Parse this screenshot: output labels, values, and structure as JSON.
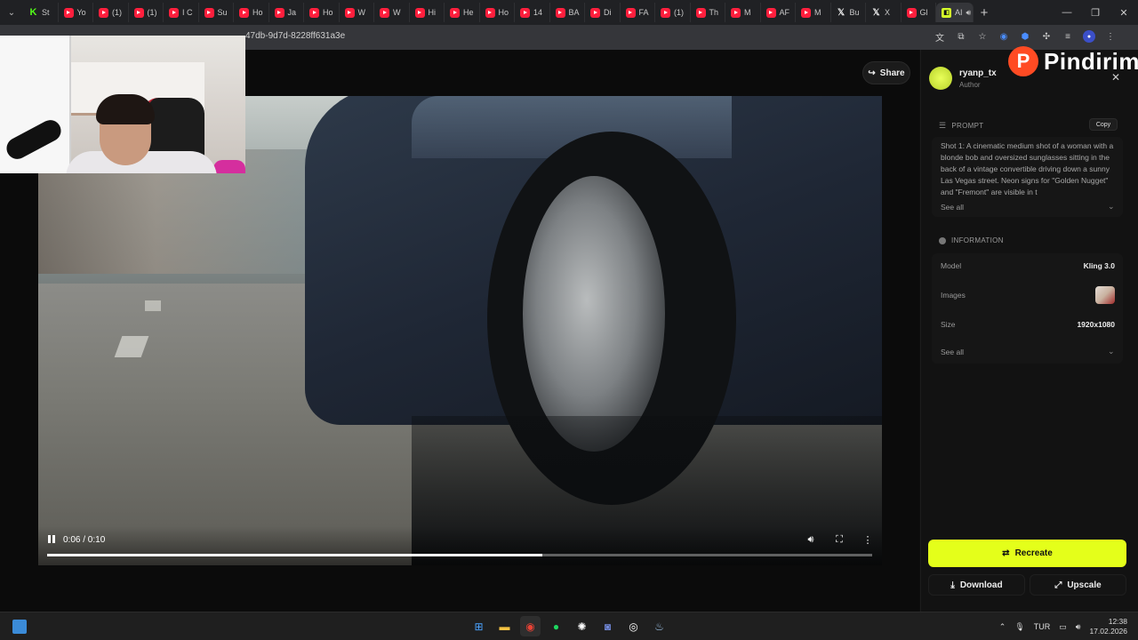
{
  "browser": {
    "tabs": [
      {
        "icon": "kick",
        "title": "St"
      },
      {
        "icon": "youtube",
        "title": "Yo"
      },
      {
        "icon": "youtube",
        "title": "(1)"
      },
      {
        "icon": "youtube",
        "title": "(1)"
      },
      {
        "icon": "youtube",
        "title": "I C"
      },
      {
        "icon": "youtube",
        "title": "Su"
      },
      {
        "icon": "youtube",
        "title": "Ho"
      },
      {
        "icon": "youtube",
        "title": "Ja"
      },
      {
        "icon": "youtube",
        "title": "Ho"
      },
      {
        "icon": "youtube",
        "title": "W"
      },
      {
        "icon": "youtube",
        "title": "W"
      },
      {
        "icon": "youtube",
        "title": "Hi"
      },
      {
        "icon": "youtube",
        "title": "He"
      },
      {
        "icon": "youtube",
        "title": "Ho"
      },
      {
        "icon": "youtube",
        "title": "14"
      },
      {
        "icon": "youtube",
        "title": "BA"
      },
      {
        "icon": "youtube",
        "title": "Di"
      },
      {
        "icon": "youtube",
        "title": "FA"
      },
      {
        "icon": "youtube",
        "title": "(1)"
      },
      {
        "icon": "youtube",
        "title": "Th"
      },
      {
        "icon": "youtube",
        "title": "M"
      },
      {
        "icon": "youtube",
        "title": "AF"
      },
      {
        "icon": "youtube",
        "title": "M"
      },
      {
        "icon": "x",
        "title": "Bu"
      },
      {
        "icon": "x",
        "title": "X"
      },
      {
        "icon": "youtube",
        "title": "Gl"
      },
      {
        "icon": "ai",
        "title": "AI"
      }
    ],
    "url": "47db-9d7d-8228ff631a3e"
  },
  "video": {
    "share_label": "Share",
    "time_label": "0:06 / 0:10",
    "progress_fraction": 0.6
  },
  "panel": {
    "brand": "Pindirim",
    "author_name": "ryanp_tx",
    "author_role": "Author",
    "prompt_heading": "PROMPT",
    "copy_label": "Copy",
    "prompt_text": "Shot 1: A cinematic medium shot of a woman with a blonde bob and oversized sunglasses sitting in the back of a vintage convertible driving down a sunny Las Vegas street. Neon signs for \"Golden Nugget\" and \"Fremont\" are visible in t",
    "see_all_prompt": "See all",
    "info_heading": "INFORMATION",
    "info": [
      {
        "key": "Model",
        "value": "Kling 3.0"
      },
      {
        "key": "Images",
        "value": ""
      },
      {
        "key": "Size",
        "value": "1920x1080"
      }
    ],
    "see_all_info": "See all",
    "recreate_label": "Recreate",
    "download_label": "Download",
    "upscale_label": "Upscale"
  },
  "taskbar": {
    "lang": "TUR",
    "time": "12:38",
    "date": "17.02.2026"
  },
  "colors": {
    "accent": "#e4ff1a",
    "brand": "#ff4b23"
  }
}
